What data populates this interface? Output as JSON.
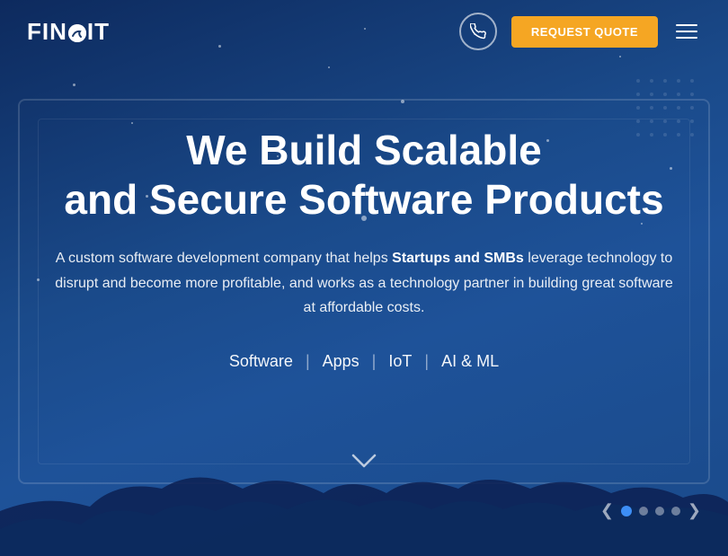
{
  "header": {
    "logo_text_start": "FIN",
    "logo_text_end": "IT",
    "phone_icon": "☎",
    "request_quote_label": "REQUEST QUOTE",
    "hamburger_aria": "menu"
  },
  "hero": {
    "title_line1": "We Build Scalable",
    "title_line2": "and Secure Software Products",
    "subtitle_prefix": "A custom software development company that helps ",
    "subtitle_bold": "Startups and SMBs",
    "subtitle_suffix": " leverage technology to disrupt and become more profitable, and works as a technology partner in building great software at affordable costs.",
    "tags": [
      "Software",
      "Apps",
      "IoT",
      "AI & ML"
    ],
    "dividers": [
      "|",
      "|",
      "|"
    ]
  },
  "carousel": {
    "dots": [
      {
        "active": true
      },
      {
        "active": false
      },
      {
        "active": false
      },
      {
        "active": false
      }
    ],
    "prev_arrow": "❮",
    "next_arrow": "❯"
  },
  "scroll_down_icon": "∨"
}
